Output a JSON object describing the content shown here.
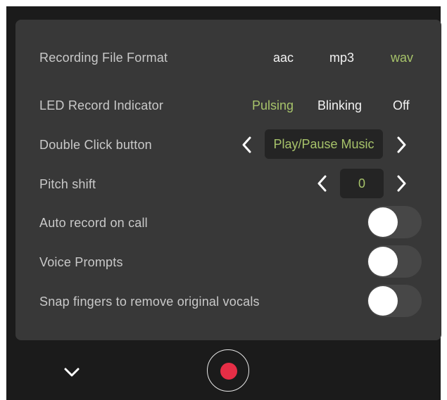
{
  "recording_format": {
    "label": "Recording File Format",
    "options": [
      "aac",
      "mp3",
      "wav"
    ],
    "selected": "wav"
  },
  "led_indicator": {
    "label": "LED Record Indicator",
    "options": [
      "Pulsing",
      "Blinking",
      "Off"
    ],
    "selected": "Pulsing"
  },
  "double_click": {
    "label": "Double Click button",
    "value": "Play/Pause Music"
  },
  "pitch_shift": {
    "label": "Pitch shift",
    "value": "0"
  },
  "auto_record": {
    "label": "Auto record on call",
    "on": false
  },
  "voice_prompts": {
    "label": "Voice Prompts",
    "on": false
  },
  "snap_fingers": {
    "label": "Snap fingers to remove original vocals",
    "on": false
  },
  "colors": {
    "accent": "#a7c36a",
    "record": "#e62e46",
    "panel": "#383838",
    "background": "#1b1b1b"
  },
  "icons": {
    "collapse": "chevron-down-icon",
    "record": "record-icon",
    "prev": "chevron-left-icon",
    "next": "chevron-right-icon"
  }
}
